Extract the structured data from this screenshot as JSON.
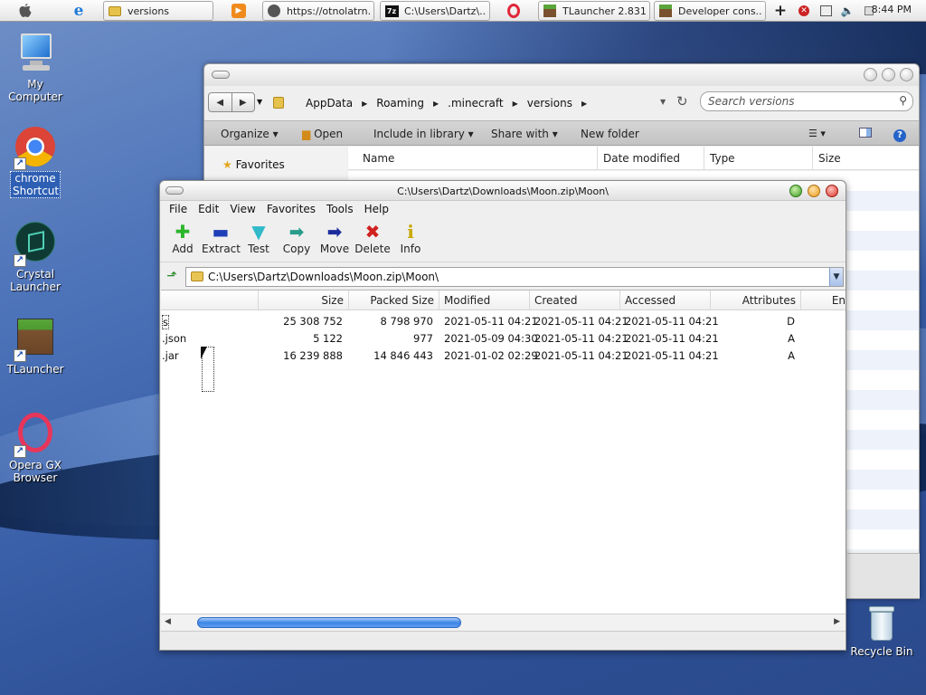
{
  "taskbar": {
    "items": [
      {
        "label": "versions",
        "icon": "folder-icon"
      },
      {
        "label": "https://otnolatrn...",
        "icon": "globe-icon"
      },
      {
        "label": "C:\\Users\\Dartz\\...",
        "icon": "sevenzip-icon"
      },
      {
        "label": "TLauncher 2.831",
        "icon": "minecraft-block-icon"
      },
      {
        "label": "Developer cons...",
        "icon": "minecraft-block-icon"
      }
    ],
    "clock": "8:44 PM"
  },
  "desktop": {
    "icons": [
      {
        "label": "My Computer"
      },
      {
        "label": "chrome Shortcut"
      },
      {
        "label": "Crystal Launcher"
      },
      {
        "label": "TLauncher"
      },
      {
        "label": "Opera GX Browser"
      },
      {
        "label": "Recycle Bin"
      }
    ]
  },
  "explorer": {
    "breadcrumbs": [
      "AppData",
      "Roaming",
      ".minecraft",
      "versions"
    ],
    "search_placeholder": "Search versions",
    "toolbar": [
      "Organize",
      "Open",
      "Include in library",
      "Share with",
      "New folder"
    ],
    "sidebar_favorites": "Favorites",
    "columns": [
      "Name",
      "Date modified",
      "Type",
      "Size"
    ]
  },
  "zip": {
    "title": "C:\\Users\\Dartz\\Downloads\\Moon.zip\\Moon\\",
    "menu": [
      "File",
      "Edit",
      "View",
      "Favorites",
      "Tools",
      "Help"
    ],
    "toolbar": [
      {
        "label": "Add",
        "icon": "add-plus-icon",
        "color": "#2bb52b",
        "glyph": "✚"
      },
      {
        "label": "Extract",
        "icon": "extract-minus-icon",
        "color": "#1f3fb8",
        "glyph": "▬"
      },
      {
        "label": "Test",
        "icon": "test-check-icon",
        "color": "#2fb9c9",
        "glyph": "✔"
      },
      {
        "label": "Copy",
        "icon": "copy-arrow-icon",
        "color": "#2a9c8c",
        "glyph": "➡"
      },
      {
        "label": "Move",
        "icon": "move-arrow-icon",
        "color": "#1c2c9c",
        "glyph": "➡"
      },
      {
        "label": "Delete",
        "icon": "delete-x-icon",
        "color": "#d02020",
        "glyph": "✖"
      },
      {
        "label": "Info",
        "icon": "info-icon",
        "color": "#c8a800",
        "glyph": "ℹ"
      }
    ],
    "address": "C:\\Users\\Dartz\\Downloads\\Moon.zip\\Moon\\",
    "columns": [
      "Size",
      "Packed Size",
      "Modified",
      "Created",
      "Accessed",
      "Attributes",
      "En"
    ],
    "rows": [
      {
        "name": "s",
        "size": "25 308 752",
        "packed": "8 798 970",
        "modified": "2021-05-11 04:21",
        "created": "2021-05-11 04:21",
        "accessed": "2021-05-11 04:21",
        "attributes": "D"
      },
      {
        "name": ".json",
        "size": "5 122",
        "packed": "977",
        "modified": "2021-05-09 04:30",
        "created": "2021-05-11 04:21",
        "accessed": "2021-05-11 04:21",
        "attributes": "A"
      },
      {
        "name": ".jar",
        "size": "16 239 888",
        "packed": "14 846 443",
        "modified": "2021-01-02 02:29",
        "created": "2021-05-11 04:21",
        "accessed": "2021-05-11 04:21",
        "attributes": "A"
      }
    ]
  }
}
